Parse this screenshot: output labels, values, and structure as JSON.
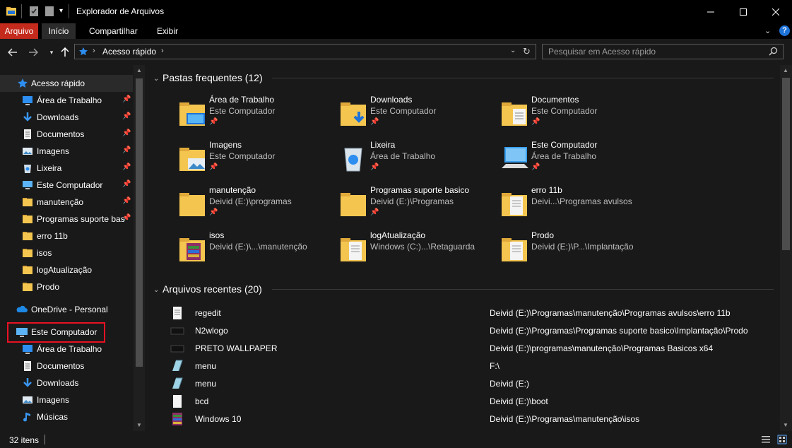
{
  "window": {
    "title": "Explorador de Arquivos",
    "buttons": {
      "minimize": "—",
      "maximize": "☐",
      "close": "✕"
    }
  },
  "ribbon": {
    "tabs": [
      "Arquivo",
      "Início",
      "Compartilhar",
      "Exibir"
    ]
  },
  "nav": {
    "address": "Acesso rápido",
    "search_placeholder": "Pesquisar em Acesso rápido"
  },
  "sidebar": {
    "quick_access": "Acesso rápido",
    "quick_items": [
      {
        "label": "Área de Trabalho",
        "icon": "desktop-icon",
        "pinned": true
      },
      {
        "label": "Downloads",
        "icon": "download-icon",
        "pinned": true
      },
      {
        "label": "Documentos",
        "icon": "document-icon",
        "pinned": true
      },
      {
        "label": "Imagens",
        "icon": "image-icon",
        "pinned": true
      },
      {
        "label": "Lixeira",
        "icon": "recycle-bin-icon",
        "pinned": true
      },
      {
        "label": "Este Computador",
        "icon": "computer-icon",
        "pinned": true
      },
      {
        "label": "manutenção",
        "icon": "folder-icon",
        "pinned": true
      },
      {
        "label": "Programas suporte bas",
        "icon": "folder-icon",
        "pinned": true
      },
      {
        "label": "erro 11b",
        "icon": "folder-icon",
        "pinned": false
      },
      {
        "label": "isos",
        "icon": "folder-icon",
        "pinned": false
      },
      {
        "label": "logAtualização",
        "icon": "folder-icon",
        "pinned": false
      },
      {
        "label": "Prodo",
        "icon": "folder-icon",
        "pinned": false
      }
    ],
    "onedrive": "OneDrive - Personal",
    "this_pc": "Este Computador",
    "pc_items": [
      {
        "label": "Área de Trabalho",
        "icon": "desktop-icon"
      },
      {
        "label": "Documentos",
        "icon": "document-icon"
      },
      {
        "label": "Downloads",
        "icon": "download-icon"
      },
      {
        "label": "Imagens",
        "icon": "image-icon"
      },
      {
        "label": "Músicas",
        "icon": "music-icon"
      }
    ]
  },
  "frequent": {
    "title": "Pastas frequentes (12)",
    "items": [
      {
        "name": "Área de Trabalho",
        "path": "Este Computador",
        "icon": "desktop-folder-icon",
        "pinned": true
      },
      {
        "name": "Downloads",
        "path": "Este Computador",
        "icon": "downloads-folder-icon",
        "pinned": true
      },
      {
        "name": "Documentos",
        "path": "Este Computador",
        "icon": "documents-folder-icon",
        "pinned": true
      },
      {
        "name": "Imagens",
        "path": "Este Computador",
        "icon": "images-folder-icon",
        "pinned": true
      },
      {
        "name": "Lixeira",
        "path": "Área de Trabalho",
        "icon": "recycle-bin-icon",
        "pinned": true
      },
      {
        "name": "Este Computador",
        "path": "Área de Trabalho",
        "icon": "computer-icon",
        "pinned": true
      },
      {
        "name": "manutenção",
        "path": "Deivid (E:)\\programas",
        "icon": "folder-icon",
        "pinned": true
      },
      {
        "name": "Programas suporte basico",
        "path": "Deivid (E:)\\Programas",
        "icon": "folder-icon",
        "pinned": true
      },
      {
        "name": "erro 11b",
        "path": "Deivi...\\Programas avulsos",
        "icon": "folder-docs-icon",
        "pinned": false
      },
      {
        "name": "isos",
        "path": "Deivid (E:)\\...\\manutenção",
        "icon": "folder-archive-icon",
        "pinned": false
      },
      {
        "name": "logAtualização",
        "path": "Windows (C:)...\\Retaguarda",
        "icon": "folder-docs-icon",
        "pinned": false
      },
      {
        "name": "Prodo",
        "path": "Deivid (E:)\\P...\\Implantação",
        "icon": "folder-docs-icon",
        "pinned": false
      }
    ]
  },
  "recent": {
    "title": "Arquivos recentes (20)",
    "items": [
      {
        "name": "regedit",
        "path": "Deivid (E:)\\Programas\\manutenção\\Programas avulsos\\erro 11b",
        "icon": "text-file-icon"
      },
      {
        "name": "N2wlogo",
        "path": "Deivid (E:)\\Programas\\Programas suporte basico\\Implantação\\Prodo",
        "icon": "image-file-icon"
      },
      {
        "name": "PRETO WALLPAPER",
        "path": "Deivid (E:)\\programas\\manutenção\\Programas Basicos x64",
        "icon": "image-file-icon"
      },
      {
        "name": "menu",
        "path": "F:\\",
        "icon": "setup-file-icon"
      },
      {
        "name": "menu",
        "path": "Deivid (E:)",
        "icon": "setup-file-icon"
      },
      {
        "name": "bcd",
        "path": "Deivid (E:)\\boot",
        "icon": "blank-file-icon"
      },
      {
        "name": "Windows 10",
        "path": "Deivid (E:)\\Programas\\manutenção\\isos",
        "icon": "archive-file-icon"
      }
    ]
  },
  "status": {
    "count": "32 itens"
  },
  "colors": {
    "accent_arquivo": "#c42b1c",
    "folder_yellow": "#f5c64f",
    "highlight_red": "#e81123"
  }
}
